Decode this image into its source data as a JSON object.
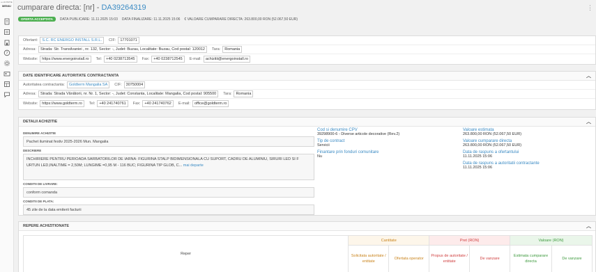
{
  "sidebar": {
    "top_label": "e-LICITATIE",
    "menu_label": "MENIU",
    "icons": [
      "document-icon",
      "list-icon",
      "building-icon",
      "help-icon",
      "settings-icon",
      "id-card-icon",
      "layout-icon",
      "chat-icon"
    ]
  },
  "header": {
    "title_prefix": "cumparare directa: [nr] -",
    "title_number": "DA39264319",
    "status_badge": "OFERTA ACCEPTATA",
    "publish_date": "DATA PUBLICARE: 11.11.2025 15:03",
    "end_date": "DATA FINALIZARE: 11.11.2025 15:06",
    "value": "€ VALOARE CUMPARARE DIRECTA: 263.800,00 RON (52.067,50 EUR)"
  },
  "ofertant": {
    "label": "Ofertant:",
    "name": "S.C. RC ENERGO INSTALL S.R.L.",
    "cif_label": "CIF:",
    "cif": "17701071",
    "address_label": "Adresa:",
    "address": "Strada: Str. Transilvaniei , nr. 132, Sector: -, Judet: Buzau, Localitate: Buzau, Cod postal: 120012",
    "country_label": "Tara:",
    "country": "Romania",
    "website_label": "Website:",
    "website": "https://www.energoinstall.ro",
    "tel_label": "Tel:",
    "tel": "+40 0238713545",
    "fax_label": "Fax:",
    "fax": "+40 0238712545",
    "email_label": "E-mail:",
    "email": "achizitii@energoinstall.ro"
  },
  "autoritate": {
    "panel_title": "DATE IDENTIFICARE AUTORITATE CONTRACTANTA",
    "label": "Autoritatea contractanta:",
    "name": "Goldterm Mangalia SA",
    "cif_label": "CIF:",
    "cif": "30750004",
    "address_label": "Adresa:",
    "address": "Strada: Strada Vânătorii, nr. Nr. 1, Sector: -, Judet: Constanta, Localitate: Mangalia, Cod postal: 905500",
    "country_label": "Tara:",
    "country": "Romania",
    "website_label": "Website:",
    "website": "https://www.goldterm.ro",
    "tel_label": "Tel:",
    "tel": "+40 241740761",
    "fax_label": "Fax:",
    "fax": "+40 241740762",
    "email_label": "E-mail:",
    "email": "office@goldterm.ro"
  },
  "detalii": {
    "panel_title": "DETALII ACHIZITIE",
    "denumire_label": "DENUMIRE ACHIZITIE",
    "denumire": "Pachet iluminat festiv 2025-2026 Mun. Mangalia",
    "descriere_label": "DESCRIERE",
    "descriere": "INCHIRIERE PENTRU PERIOADA SARBATORILOR DE IARNA: FIGURINA STALP BIDIMENSIONALA CU SUPORT, CADRU DE ALUMINIU, SIRURI LED SI F URTUN LED,INALTIME = 2,50M; LUNGIME =0,95 M - 116 BUC; FIGURINA TIP GLOB, C...",
    "mai_departe": "mai departe",
    "livrare_label": "CONDITII DE LIVRARE:",
    "livrare": "conform comanda",
    "plata_label": "CONDITII DE PLATA:",
    "plata": "45 zile de la data emiterii facturii",
    "cpv_label": "Cod si denumire CPV",
    "cpv": "39298900-6 - Diverse articole decorative (Rev.2)",
    "tip_label": "Tip de contract",
    "tip": "Servicii",
    "fonduri_label": "Finantare prin fonduri comunitare",
    "fonduri": "Nu",
    "val_est_label": "Valoare estimata",
    "val_est": "263.800,00   RON (52.067,50  EUR)",
    "val_cump_label": "Valoare cumparare directa",
    "val_cump": "263.800,00   RON (52.067,50  EUR)",
    "raspuns_ofertant_label": "Data de raspuns a ofertantului",
    "raspuns_ofertant": "11.11.2025 15:06",
    "raspuns_autoritate_label": "Data de raspuns a autoritatii contractante",
    "raspuns_autoritate": "11.11.2025 15:06"
  },
  "repere": {
    "panel_title": "REPERE ACHIZITIONATE",
    "col_reper": "Reper",
    "grp_cantitate": "Cantitate",
    "grp_pret": "Pret (RON)",
    "grp_valoare": "Valoare (RON)",
    "sub_solicitata": "Solicitata autoritate / entitate",
    "sub_ofertata": "Ofertata operator",
    "sub_propus": "Propus de autoritate / entitate",
    "sub_vanzare1": "De vanzare",
    "sub_estimata": "Estimata cumparare directa",
    "sub_vanzare2": "De vanzare"
  }
}
